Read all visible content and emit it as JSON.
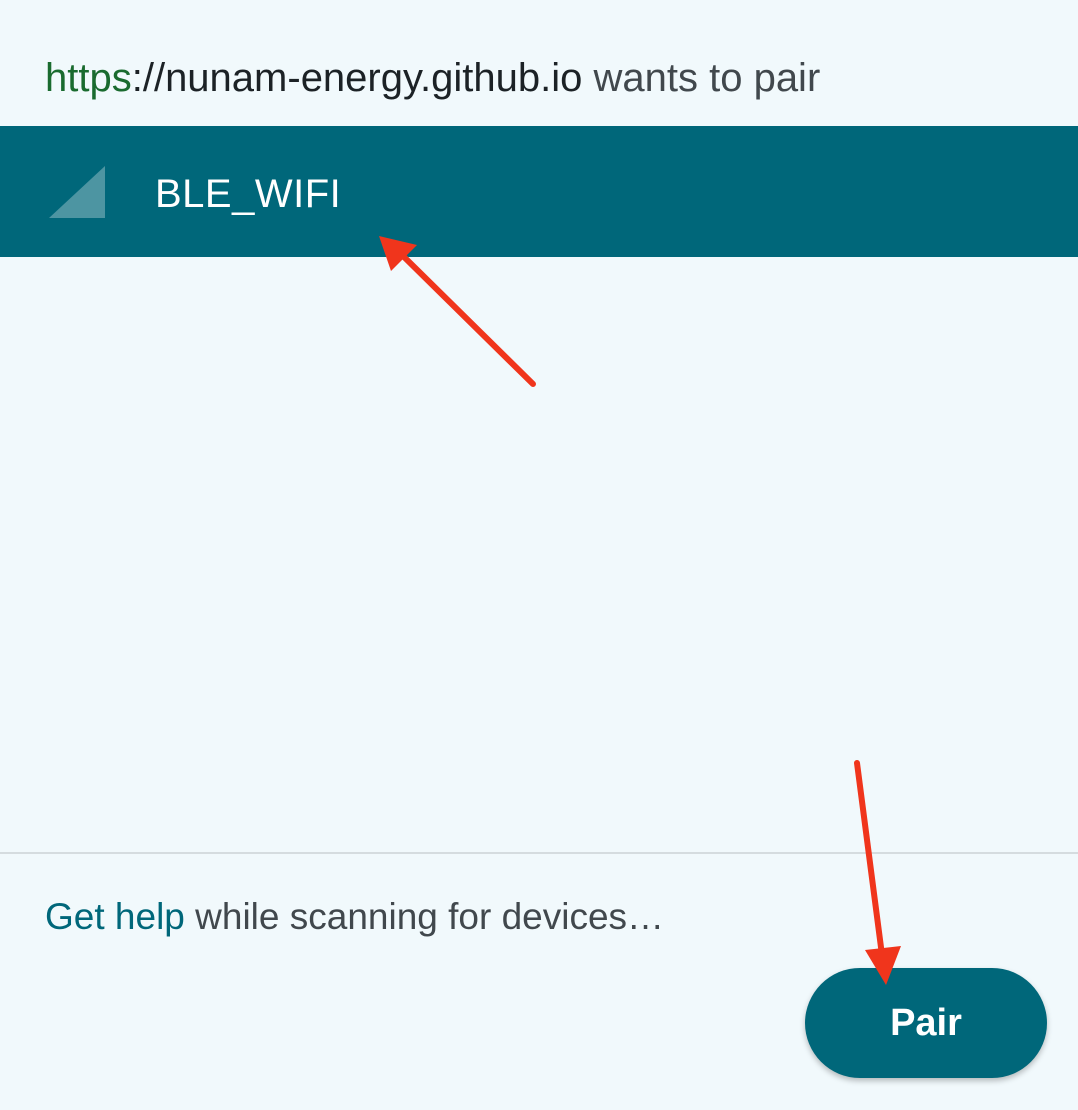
{
  "header": {
    "scheme": "https",
    "separator": "://",
    "host": "nunam-energy.github.io",
    "rest": " wants to pair"
  },
  "device": {
    "icon": "signal-strength-icon",
    "name": "BLE_WIFI"
  },
  "footer": {
    "help_link": "Get help",
    "help_rest": " while scanning for devices…"
  },
  "actions": {
    "pair_label": "Pair"
  },
  "colors": {
    "accent": "#00677a",
    "background": "#f1f9fc",
    "scheme_green": "#1a6b2f",
    "annotation_arrow": "#f0351c"
  }
}
